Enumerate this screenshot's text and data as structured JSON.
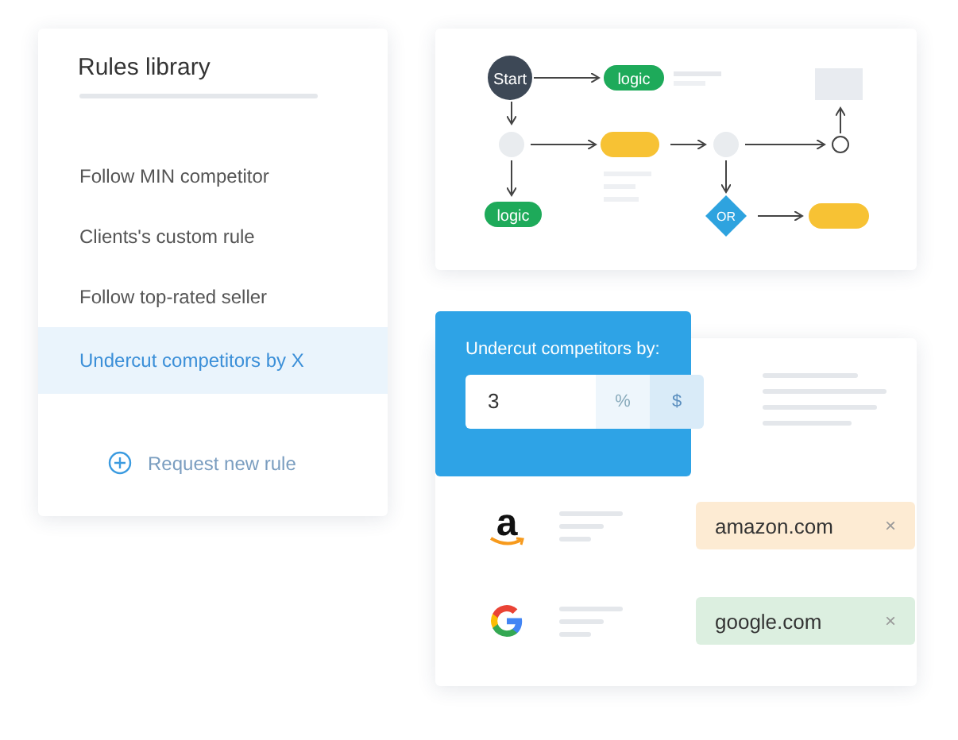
{
  "rules_library": {
    "title": "Rules library",
    "items": [
      {
        "label": "Follow MIN competitor",
        "selected": false
      },
      {
        "label": "Clients's custom rule",
        "selected": false
      },
      {
        "label": "Follow top-rated seller",
        "selected": false
      },
      {
        "label": "Undercut competitors by X",
        "selected": true
      }
    ],
    "request_button": "Request new rule"
  },
  "flowchart": {
    "start": "Start",
    "logic_nodes": [
      "logic",
      "logic"
    ],
    "decision": "OR"
  },
  "undercut": {
    "title": "Undercut competitors by:",
    "value": "3",
    "units": [
      {
        "label": "%",
        "selected": false
      },
      {
        "label": "$",
        "selected": true
      }
    ]
  },
  "competitors": [
    {
      "kind": "amazon",
      "logo": "a",
      "domain": "amazon.com",
      "remove": "×",
      "color": "#fdebd3"
    },
    {
      "kind": "google",
      "domain": "google.com",
      "remove": "×",
      "color": "#dcefe0"
    }
  ]
}
